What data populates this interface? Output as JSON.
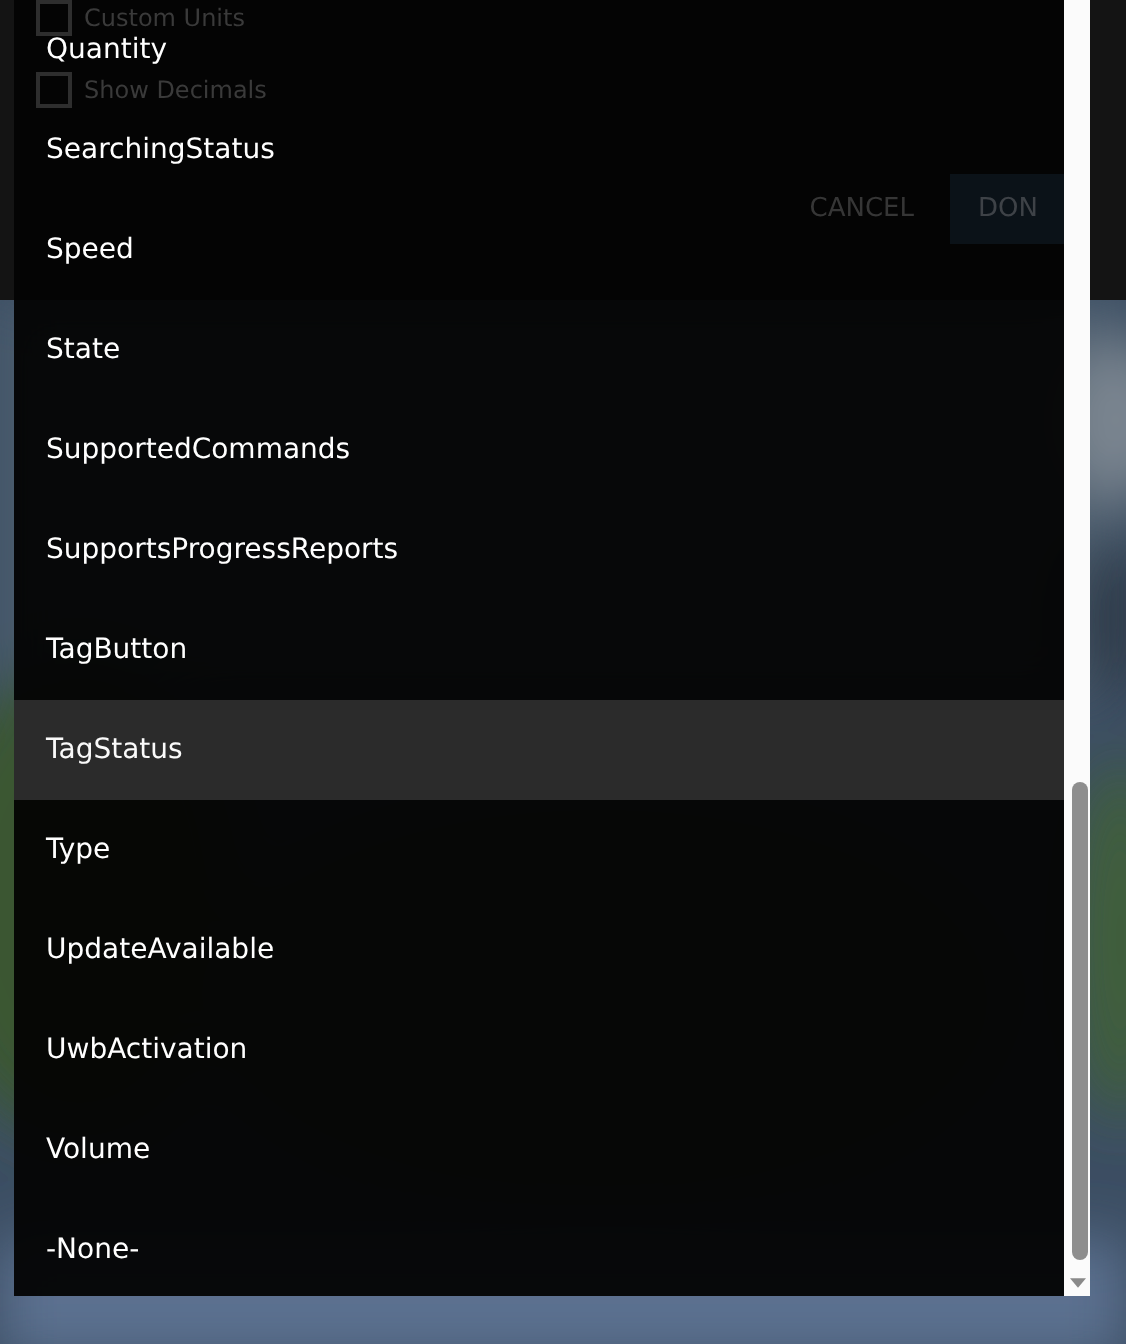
{
  "dialog": {
    "options": [
      {
        "label": "Custom Units",
        "checked": false
      },
      {
        "label": "Show Decimals",
        "checked": false
      }
    ],
    "buttons": [
      {
        "label": "CANCEL",
        "kind": "text"
      },
      {
        "label": "DON",
        "kind": "primary"
      }
    ]
  },
  "dropdown": {
    "items": [
      {
        "label": "Quantity",
        "selected": false
      },
      {
        "label": "SearchingStatus",
        "selected": false
      },
      {
        "label": "Speed",
        "selected": false
      },
      {
        "label": "State",
        "selected": false
      },
      {
        "label": "SupportedCommands",
        "selected": false
      },
      {
        "label": "SupportsProgressReports",
        "selected": false
      },
      {
        "label": "TagButton",
        "selected": false
      },
      {
        "label": "TagStatus",
        "selected": true
      },
      {
        "label": "Type",
        "selected": false
      },
      {
        "label": "UpdateAvailable",
        "selected": false
      },
      {
        "label": "UwbActivation",
        "selected": false
      },
      {
        "label": "Volume",
        "selected": false
      },
      {
        "label": "-None-",
        "selected": false
      }
    ]
  }
}
